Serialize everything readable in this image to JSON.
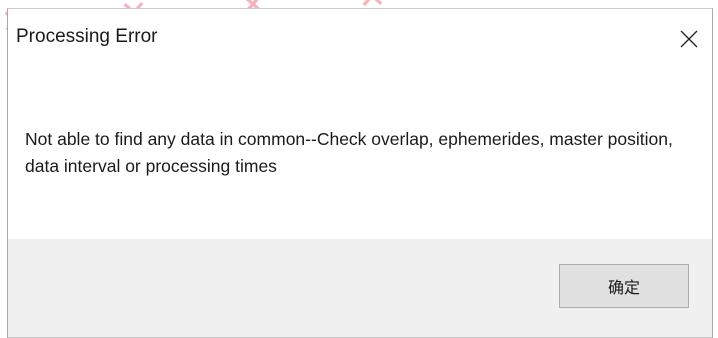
{
  "dialog": {
    "title": "Processing Error",
    "close_icon": "close-icon",
    "message": "Not able to find any data in common--Check overlap, ephemerides, master position, data interval or processing times",
    "ok_button_label": "确定"
  },
  "colors": {
    "footer_background": "#f0f0f0",
    "button_background": "#e1e1e1",
    "button_border": "#adadad",
    "watermark": "#e1283c"
  }
}
